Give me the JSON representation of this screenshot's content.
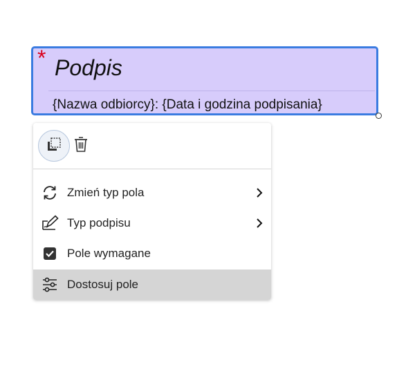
{
  "field": {
    "required_marker": "*",
    "title": "Podpis",
    "subtitle": "{Nazwa odbiorcy}: {Data i godzina podpisania}"
  },
  "menu": {
    "top_actions": [
      {
        "icon": "copy-icon"
      },
      {
        "icon": "trash-icon"
      }
    ],
    "items": [
      {
        "label": "Zmień typ pola",
        "icon": "refresh-icon",
        "has_submenu": true
      },
      {
        "label": "Typ podpisu",
        "icon": "signature-pen-icon",
        "has_submenu": true
      },
      {
        "label": "Pole wymagane",
        "icon": "checkbox-icon",
        "checked": true
      },
      {
        "label": "Dostosuj pole",
        "icon": "sliders-icon",
        "highlighted": true
      }
    ]
  },
  "colors": {
    "field_fill": "#d7ccfb",
    "field_border": "#3a7be0",
    "required_star": "#d9001b",
    "highlight": "#d5d5d5"
  }
}
